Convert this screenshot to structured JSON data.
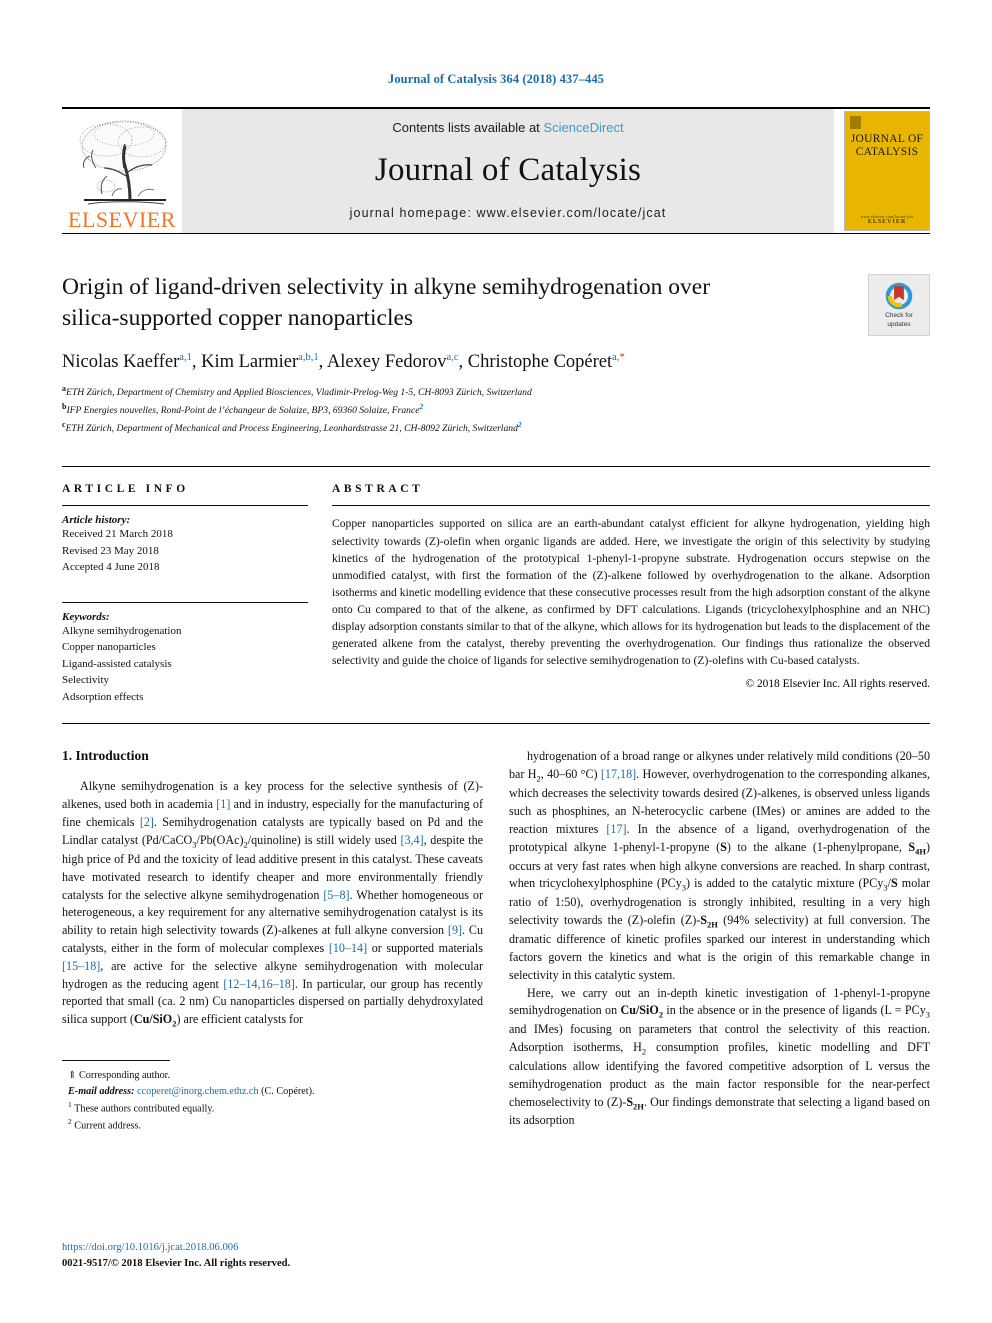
{
  "running_head": "Journal of Catalysis 364 (2018) 437–445",
  "masthead": {
    "contents_prefix": "Contents lists available at ",
    "sciencedirect": "ScienceDirect",
    "journal_name": "Journal of Catalysis",
    "homepage": "journal homepage: www.elsevier.com/locate/jcat",
    "publisher_logo_text": "ELSEVIER",
    "cover_title_line1": "JOURNAL OF",
    "cover_title_line2": "CATALYSIS",
    "cover_footer_small": "www.elsevier.com/locate/jcat",
    "cover_footer_brand": "ELSEVIER",
    "colors": {
      "link_blue": "#3d9ad1",
      "running_head_blue": "#1b6ca8",
      "elsevier_orange": "#ee7623",
      "cover_yellow": "#e8b500",
      "masthead_grey": "#e8e8e8"
    }
  },
  "title": {
    "line1": "Origin of ligand-driven selectivity in alkyne semihydrogenation over",
    "line2": "silica-supported copper nanoparticles"
  },
  "crossmark": {
    "label_line1": "Check for",
    "label_line2": "updates"
  },
  "authors": [
    {
      "name": "Nicolas Kaeffer",
      "marks": "a,1",
      "sep": ", "
    },
    {
      "name": "Kim Larmier",
      "marks": "a,b,1",
      "sep": ", "
    },
    {
      "name": "Alexey Fedorov",
      "marks": "a,c",
      "sep": ", "
    },
    {
      "name": "Christophe Copéret",
      "marks": "a,",
      "star": "*",
      "sep": ""
    }
  ],
  "affiliations": [
    {
      "label": "a",
      "text": "ETH Zürich, Department of Chemistry and Applied Biosciences, Vladimir-Prelog-Weg 1-5, CH-8093 Zürich, Switzerland",
      "note": ""
    },
    {
      "label": "b",
      "text": "IFP Energies nouvelles, Rond-Point de l’échangeur de Solaize, BP3, 69360 Solaize, France",
      "note": "2"
    },
    {
      "label": "c",
      "text": "ETH Zürich, Department of Mechanical and Process Engineering, Leonhardstrasse 21, CH-8092 Zürich, Switzerland",
      "note": "2"
    }
  ],
  "article_info": {
    "heading": "ARTICLE INFO",
    "history_label": "Article history:",
    "history": [
      "Received 21 March 2018",
      "Revised 23 May 2018",
      "Accepted 4 June 2018"
    ],
    "keywords_label": "Keywords:",
    "keywords": [
      "Alkyne semihydrogenation",
      "Copper nanoparticles",
      "Ligand-assisted catalysis",
      "Selectivity",
      "Adsorption effects"
    ]
  },
  "abstract": {
    "heading": "ABSTRACT",
    "body": "Copper nanoparticles supported on silica are an earth-abundant catalyst efficient for alkyne hydrogenation, yielding high selectivity towards (Z)-olefin when organic ligands are added. Here, we investigate the origin of this selectivity by studying kinetics of the hydrogenation of the prototypical 1-phenyl-1-propyne substrate. Hydrogenation occurs stepwise on the unmodified catalyst, with first the formation of the (Z)-alkene followed by overhydrogenation to the alkane. Adsorption isotherms and kinetic modelling evidence that these consecutive processes result from the high adsorption constant of the alkyne onto Cu compared to that of the alkene, as confirmed by DFT calculations. Ligands (tricyclohexylphosphine and an NHC) display adsorption constants similar to that of the alkyne, which allows for its hydrogenation but leads to the displacement of the generated alkene from the catalyst, thereby preventing the overhydrogenation. Our findings thus rationalize the observed selectivity and guide the choice of ligands for selective semihydrogenation to (Z)-olefins with Cu-based catalysts.",
    "copyright": "© 2018 Elsevier Inc. All rights reserved."
  },
  "body": {
    "section_heading": "1. Introduction",
    "left_paragraph_html": "Alkyne semihydrogenation is a key process for the selective synthesis of (Z)-alkenes, used both in academia <span class=\"ref\">[1]</span> and in industry, especially for the manufacturing of fine chemicals <span class=\"ref\">[2]</span>. Semihydrogenation catalysts are typically based on Pd and the Lindlar catalyst (Pd/CaCO<sub>3</sub>/Pb(OAc)<sub>2</sub>/quinoline) is still widely used <span class=\"ref\">[3,4]</span>, despite the high price of Pd and the toxicity of lead additive present in this catalyst. These caveats have motivated research to identify cheaper and more environmentally friendly catalysts for the selective alkyne semihydrogenation <span class=\"ref\">[5–8]</span>. Whether homogeneous or heterogeneous, a key requirement for any alternative semihydrogenation catalyst is its ability to retain high selectivity towards (Z)-alkenes at full alkyne conversion <span class=\"ref\">[9]</span>. Cu catalysts, either in the form of molecular complexes <span class=\"ref\">[10–14]</span> or supported materials <span class=\"ref\">[15–18]</span>, are active for the selective alkyne semihydrogenation with molecular hydrogen as the reducing agent <span class=\"ref\">[12–14,16–18]</span>. In particular, our group has recently reported that small (ca. 2 nm) Cu nanoparticles dispersed on partially dehydroxylated silica support (<b>Cu/SiO<sub>2</sub></b>) are efficient catalysts for",
    "right_paragraph1_html": "hydrogenation of a broad range or alkynes under relatively mild conditions (20–50 bar H<sub>2</sub>, 40–60 °C) <span class=\"ref\">[17,18]</span>. However, overhydrogenation to the corresponding alkanes, which decreases the selectivity towards desired (Z)-alkenes, is observed unless ligands such as phosphines, an N-heterocyclic carbene (IMes) or amines are added to the reaction mixtures <span class=\"ref\">[17]</span>. In the absence of a ligand, overhydrogenation of the prototypical alkyne 1-phenyl-1-propyne (<b>S</b>) to the alkane (1-phenylpropane, <b>S<sub>4H</sub></b>) occurs at very fast rates when high alkyne conversions are reached. In sharp contrast, when tricyclohexylphosphine (PCy<sub>3</sub>) is added to the catalytic mixture (PCy<sub>3</sub>/<b>S</b> molar ratio of 1:50), overhydrogenation is strongly inhibited, resulting in a very high selectivity towards the (Z)-olefin (Z)-<b>S<sub>2H</sub></b> (94% selectivity) at full conversion. The dramatic difference of kinetic profiles sparked our interest in understanding which factors govern the kinetics and what is the origin of this remarkable change in selectivity in this catalytic system.",
    "right_paragraph2_html": "Here, we carry out an in-depth kinetic investigation of 1-phenyl-1-propyne semihydrogenation on <b>Cu/SiO<sub>2</sub></b> in the absence or in the presence of ligands (L = PCy<sub>3</sub> and IMes) focusing on parameters that control the selectivity of this reaction. Adsorption isotherms, H<sub>2</sub> consumption profiles, kinetic modelling and DFT calculations allow identifying the favored competitive adsorption of L versus the semihydrogenation product as the main factor responsible for the near-perfect chemoselectivity to (Z)-<b>S<sub>2H</sub></b>. Our findings demonstrate that selecting a ligand based on its adsorption"
  },
  "footnotes": {
    "corresponding_symbol": "⇑",
    "corresponding_text": "Corresponding author.",
    "email_label": "E-mail address:",
    "email": "ccoperet@inorg.chem.ethz.ch",
    "email_owner": "(C. Copéret).",
    "note1_num": "1",
    "note1_text": "These authors contributed equally.",
    "note2_num": "2",
    "note2_text": "Current address."
  },
  "page_footer": {
    "doi": "https://doi.org/10.1016/j.jcat.2018.06.006",
    "issn_line": "0021-9517/© 2018 Elsevier Inc. All rights reserved."
  }
}
